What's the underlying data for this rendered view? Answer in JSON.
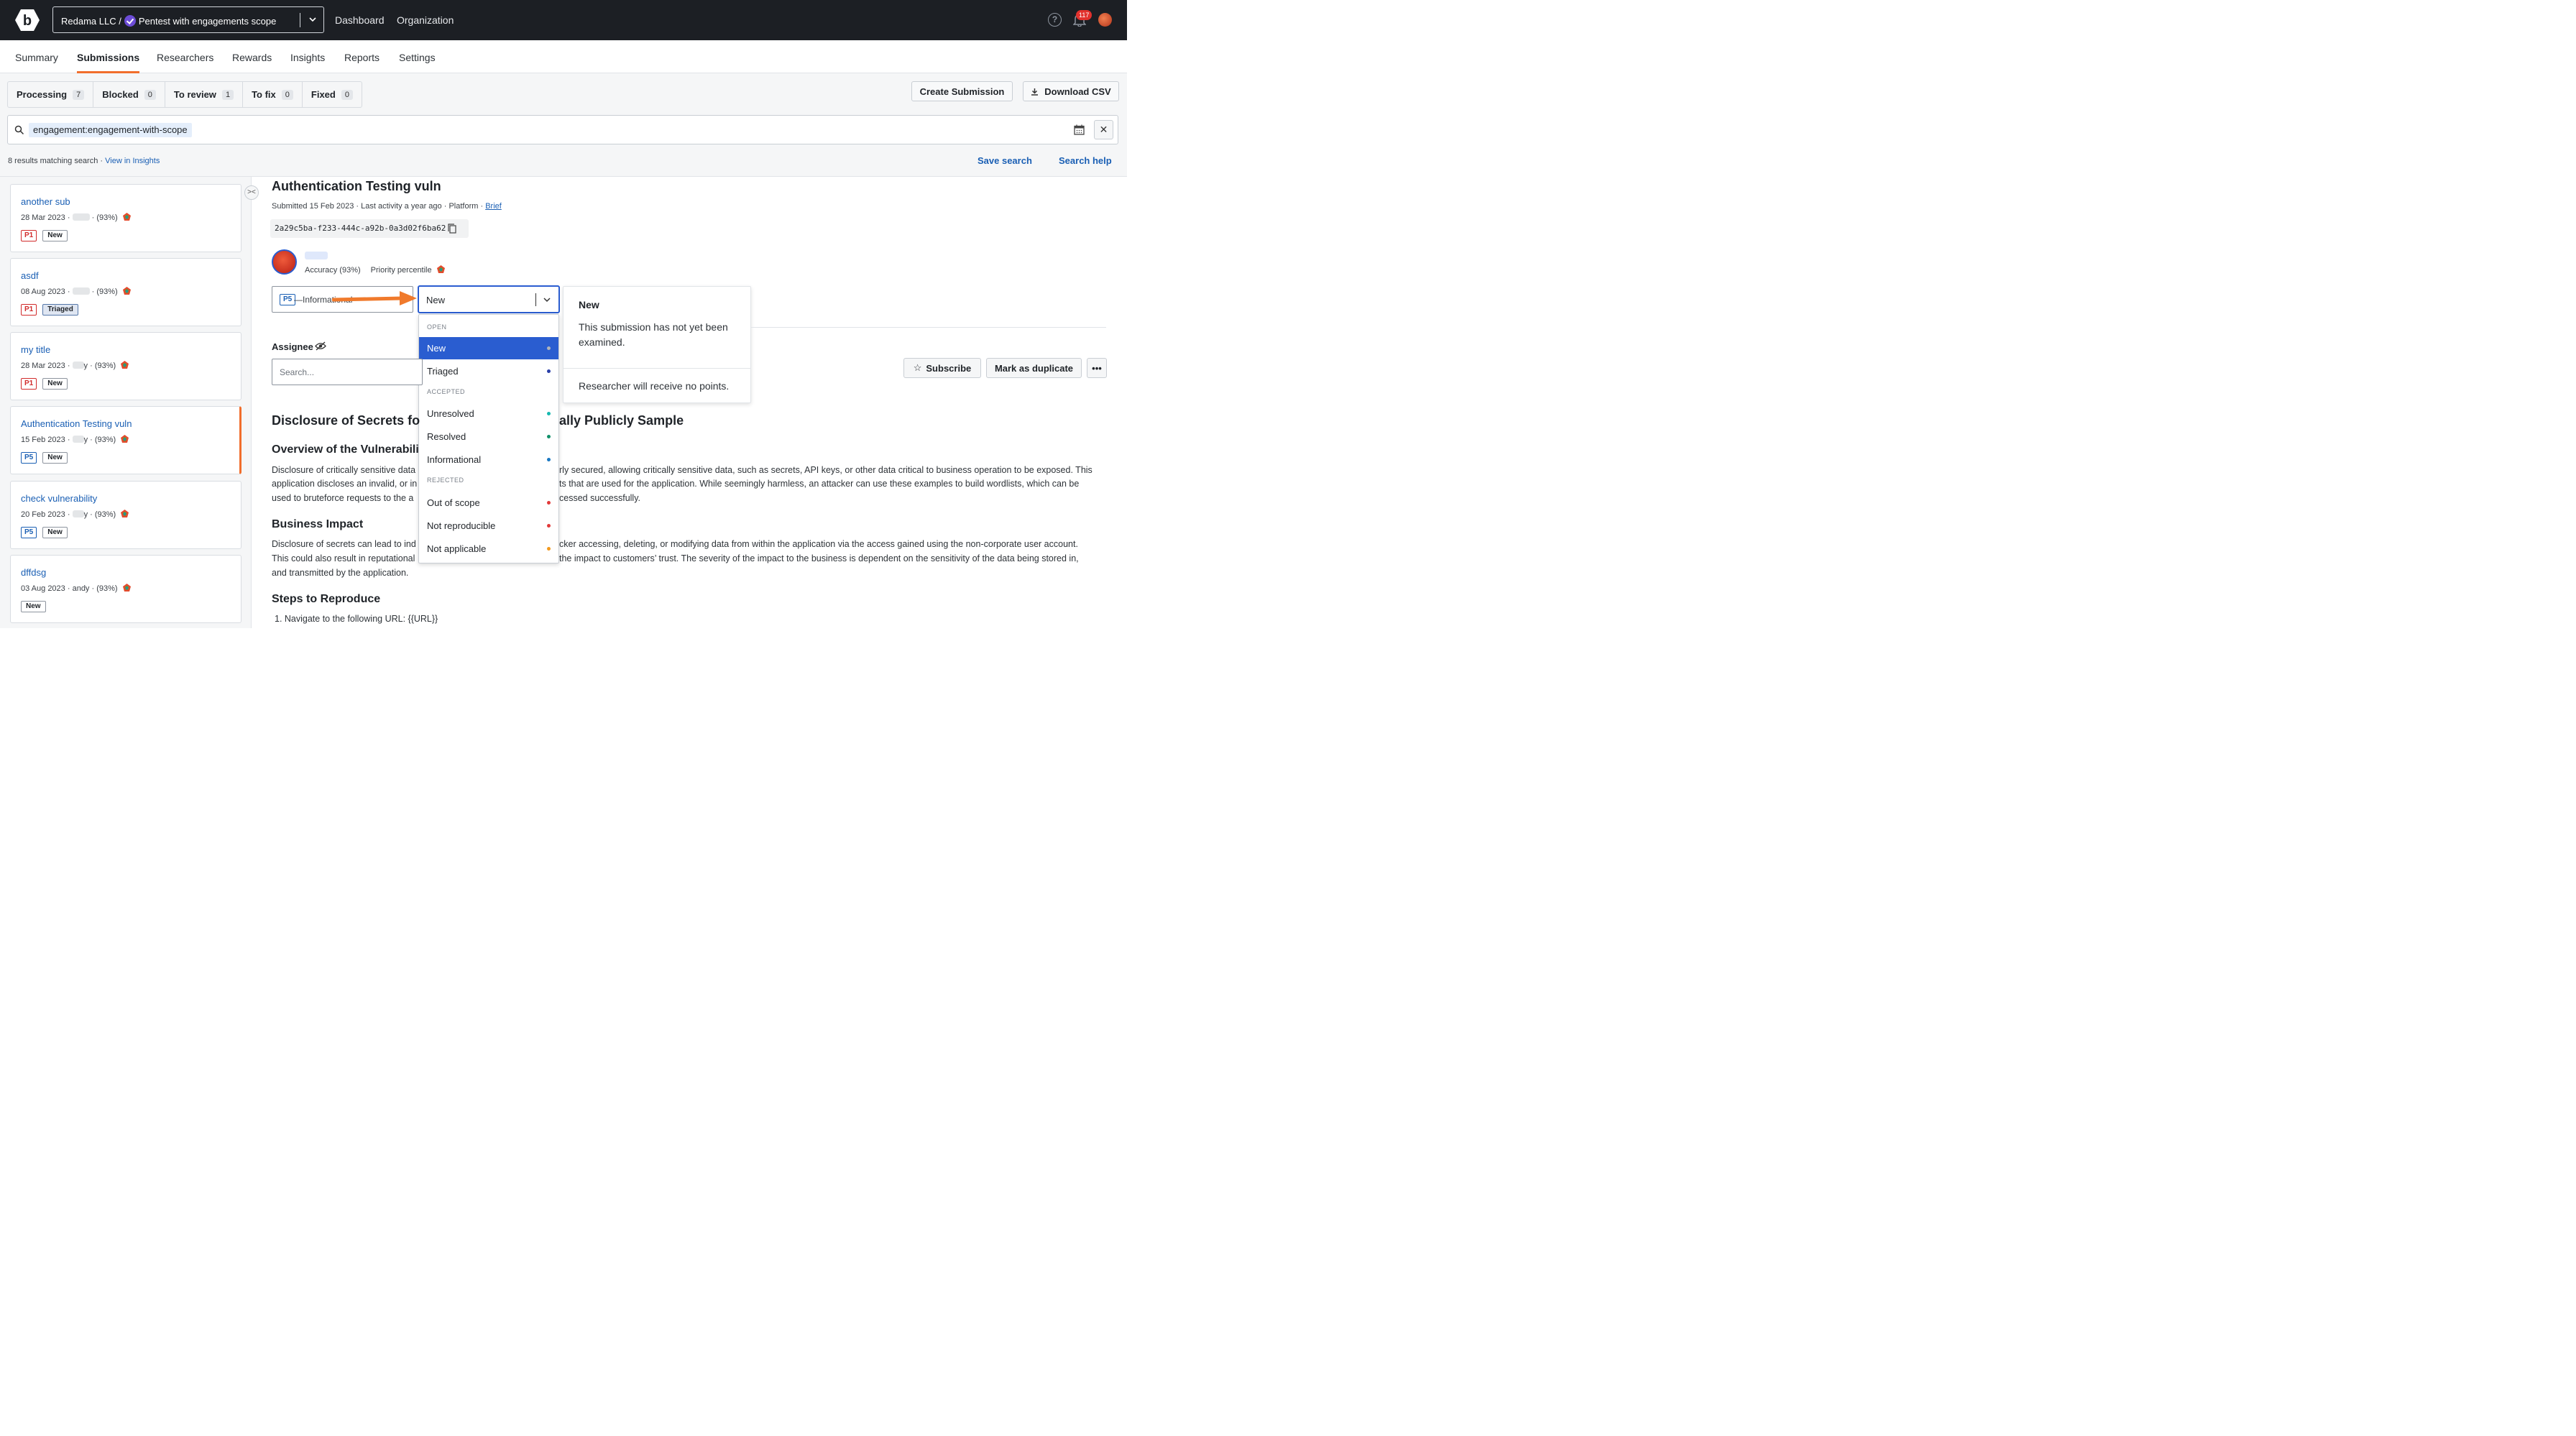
{
  "topbar": {
    "org_label": "Redama LLC /",
    "program_label": "Pentest with engagements scope",
    "nav": [
      "Dashboard",
      "Organization"
    ],
    "notification_count": "117"
  },
  "tabs": [
    "Summary",
    "Submissions",
    "Researchers",
    "Rewards",
    "Insights",
    "Reports",
    "Settings"
  ],
  "status_filters": [
    {
      "label": "Processing",
      "count": "7"
    },
    {
      "label": "Blocked",
      "count": "0"
    },
    {
      "label": "To review",
      "count": "1"
    },
    {
      "label": "To fix",
      "count": "0"
    },
    {
      "label": "Fixed",
      "count": "0"
    }
  ],
  "actions": {
    "create": "Create Submission",
    "download": "Download CSV",
    "save_search": "Save search",
    "search_help": "Search help"
  },
  "search": {
    "query": "engagement:engagement-with-scope",
    "results": "8 results matching search",
    "view_insights": "View in Insights"
  },
  "submissions": [
    {
      "title": "another sub",
      "date": "28 Mar 2023",
      "researcher": "",
      "accuracy": "(93%)",
      "priority": "P1",
      "status": "New"
    },
    {
      "title": "asdf",
      "date": "08 Aug 2023",
      "researcher": "",
      "accuracy": "(93%)",
      "priority": "P1",
      "status": "Triaged"
    },
    {
      "title": "my title",
      "date": "28 Mar 2023",
      "researcher": "y",
      "accuracy": "(93%)",
      "priority": "P1",
      "status": "New"
    },
    {
      "title": "Authentication Testing vuln",
      "date": "15 Feb 2023",
      "researcher": "y",
      "accuracy": "(93%)",
      "priority": "P5",
      "status": "New"
    },
    {
      "title": "check vulnerability",
      "date": "20 Feb 2023",
      "researcher": "y",
      "accuracy": "(93%)",
      "priority": "P5",
      "status": "New"
    },
    {
      "title": "dffdsg",
      "date": "03 Aug 2023",
      "researcher": "andy",
      "accuracy": "(93%)",
      "priority": "",
      "status": "New"
    }
  ],
  "detail": {
    "title": "Authentication Testing vuln",
    "submitted": "Submitted 15 Feb 2023",
    "last_activity": "Last activity a year ago",
    "platform": "Platform",
    "brief": "Brief",
    "uuid": "2a29c5ba-f233-444c-a92b-0a3d02f6ba62",
    "accuracy": "Accuracy (93%)",
    "priority_percentile": "Priority percentile",
    "severity_badge": "P5",
    "severity_text": "—Informational",
    "status_value": "New",
    "assignee_label": "Assignee",
    "assignee_placeholder": "Search...",
    "subscribe": "Subscribe",
    "mark_duplicate": "Mark as duplicate"
  },
  "dropdown": {
    "groups": [
      "OPEN",
      "ACCEPTED",
      "REJECTED"
    ],
    "items": [
      {
        "label": "New",
        "color": "#b0b4ba"
      },
      {
        "label": "Triaged",
        "color": "#2a3fa8"
      },
      {
        "label": "Unresolved",
        "color": "#17b8b0"
      },
      {
        "label": "Resolved",
        "color": "#10906a"
      },
      {
        "label": "Informational",
        "color": "#1a78c2"
      },
      {
        "label": "Out of scope",
        "color": "#e23a3a"
      },
      {
        "label": "Not reproducible",
        "color": "#e23a3a"
      },
      {
        "label": "Not applicable",
        "color": "#f39a1e"
      }
    ]
  },
  "tooltip": {
    "title": "New",
    "description": "This submission has not yet been examined.",
    "footer": "Researcher will receive no points."
  },
  "content": {
    "h1_left": "Disclosure of Secrets fo",
    "h1_right": "ally Publicly Sample",
    "overview_heading": "Overview of the Vulnerabili",
    "overview_left": [
      "Disclosure of critically sensitive data",
      "application discloses an invalid, or in",
      "used to bruteforce requests to the a"
    ],
    "overview_right": [
      "rly secured, allowing critically sensitive data, such as secrets, API keys, or other data critical to business operation to be exposed. This",
      "ts that are used for the application. While seemingly harmless, an attacker can use these examples to build wordlists, which can be",
      "cessed successfully."
    ],
    "impact_heading": "Business Impact",
    "impact_left": [
      "Disclosure of secrets can lead to ind",
      "This could also result in reputational",
      "and transmitted by the application."
    ],
    "impact_right": [
      "cker accessing, deleting, or modifying data from within the application via the access gained using the non-corporate user account.",
      "the impact to customers’ trust. The severity of the impact to the business is dependent on the sensitivity of the data being stored in,"
    ],
    "steps_heading": "Steps to Reproduce",
    "step1": "1. Navigate to the following URL: {{URL}}"
  }
}
